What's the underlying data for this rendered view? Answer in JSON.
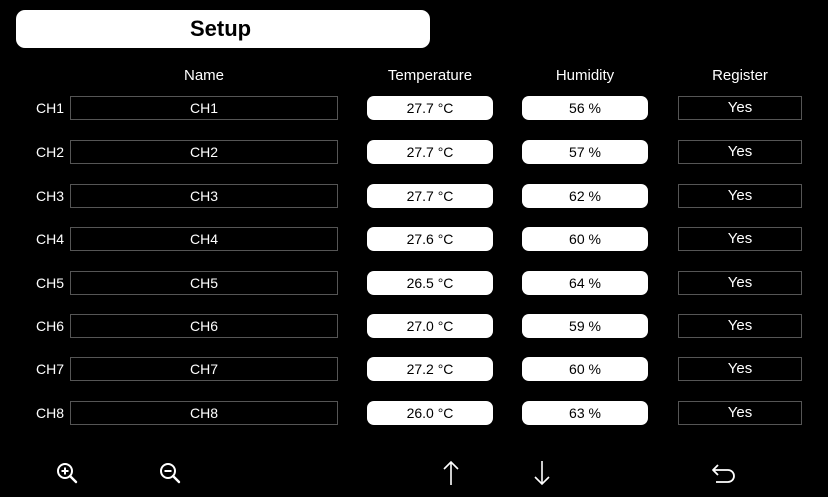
{
  "header": {
    "title": "Setup"
  },
  "columns": {
    "name": "Name",
    "temperature": "Temperature",
    "humidity": "Humidity",
    "register": "Register"
  },
  "rows": [
    {
      "channel": "CH1",
      "name": "CH1",
      "temperature": "27.7 °C",
      "humidity": "56 %",
      "register": "Yes"
    },
    {
      "channel": "CH2",
      "name": "CH2",
      "temperature": "27.7 °C",
      "humidity": "57 %",
      "register": "Yes"
    },
    {
      "channel": "CH3",
      "name": "CH3",
      "temperature": "27.7 °C",
      "humidity": "62 %",
      "register": "Yes"
    },
    {
      "channel": "CH4",
      "name": "CH4",
      "temperature": "27.6 °C",
      "humidity": "60 %",
      "register": "Yes"
    },
    {
      "channel": "CH5",
      "name": "CH5",
      "temperature": "26.5 °C",
      "humidity": "64 %",
      "register": "Yes"
    },
    {
      "channel": "CH6",
      "name": "CH6",
      "temperature": "27.0 °C",
      "humidity": "59 %",
      "register": "Yes"
    },
    {
      "channel": "CH7",
      "name": "CH7",
      "temperature": "27.2 °C",
      "humidity": "60 %",
      "register": "Yes"
    },
    {
      "channel": "CH8",
      "name": "CH8",
      "temperature": "26.0 °C",
      "humidity": "63 %",
      "register": "Yes"
    }
  ],
  "toolbar": {
    "icons": [
      "zoom-in-icon",
      "zoom-out-icon",
      "arrow-up-icon",
      "arrow-down-icon",
      "back-icon"
    ]
  },
  "colors": {
    "background": "#000000",
    "foreground": "#ffffff",
    "field_border": "#555555"
  }
}
